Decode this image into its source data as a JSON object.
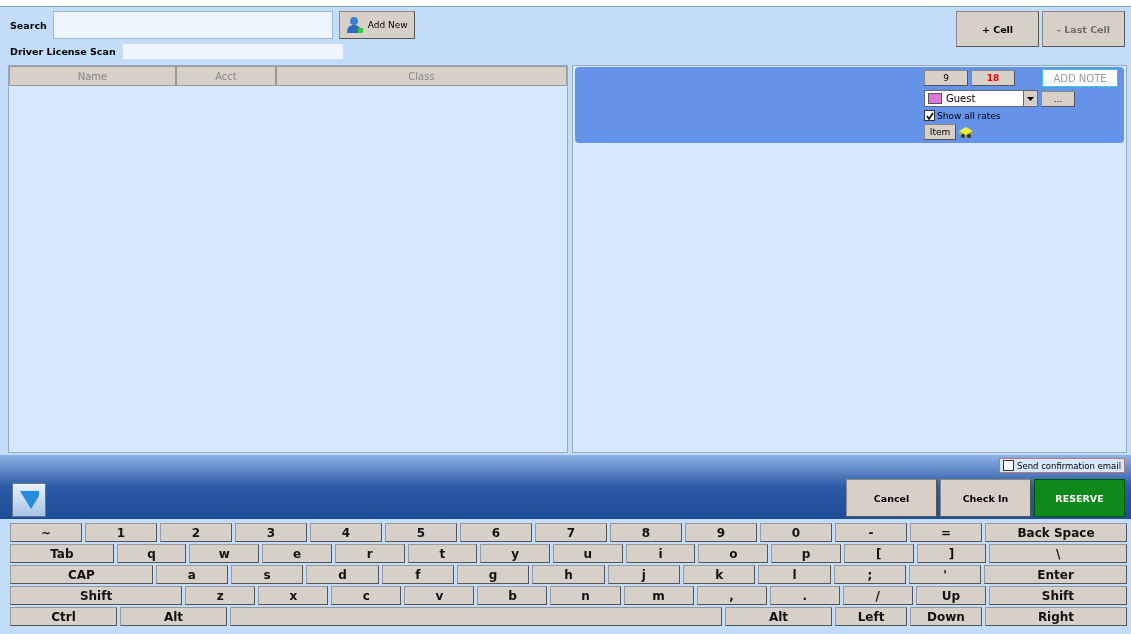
{
  "search": {
    "label": "Search",
    "add_new": "Add New"
  },
  "license_scan": {
    "label": "Driver License Scan"
  },
  "cell_buttons": [
    {
      "label": "+ Cell",
      "disabled": false
    },
    {
      "label": "- Last Cell",
      "disabled": true
    }
  ],
  "table": {
    "columns": [
      "Name",
      "Acct",
      "Class"
    ]
  },
  "cell": {
    "count_a": "9",
    "count_b": "18",
    "note": "ADD NOTE",
    "rate_type": {
      "value": "Guest",
      "color": "#dd77dd"
    },
    "more": "...",
    "show_all_rates": {
      "label": "Show all rates",
      "checked": true
    },
    "item": "Item"
  },
  "send_confirmation": {
    "label": "Send confirmation email",
    "checked": false
  },
  "actions": [
    {
      "label": "Cancel",
      "kind": "plain"
    },
    {
      "label": "Check In",
      "kind": "plain"
    },
    {
      "label": "RESERVE",
      "kind": "primary"
    }
  ],
  "keyboard": [
    [
      {
        "label": "~",
        "kind": "char"
      },
      {
        "label": "1",
        "kind": "char"
      },
      {
        "label": "2",
        "kind": "char"
      },
      {
        "label": "3",
        "kind": "char"
      },
      {
        "label": "4",
        "kind": "char"
      },
      {
        "label": "5",
        "kind": "char"
      },
      {
        "label": "6",
        "kind": "char"
      },
      {
        "label": "7",
        "kind": "char"
      },
      {
        "label": "8",
        "kind": "char"
      },
      {
        "label": "9",
        "kind": "char"
      },
      {
        "label": "0",
        "kind": "char"
      },
      {
        "label": "-",
        "kind": "char"
      },
      {
        "label": "=",
        "kind": "char"
      },
      {
        "label": "Back Space",
        "kind": "wide"
      }
    ],
    [
      {
        "label": "Tab",
        "kind": "mod"
      },
      {
        "label": "q",
        "kind": "char"
      },
      {
        "label": "w",
        "kind": "char"
      },
      {
        "label": "e",
        "kind": "char"
      },
      {
        "label": "r",
        "kind": "char"
      },
      {
        "label": "t",
        "kind": "char"
      },
      {
        "label": "y",
        "kind": "char"
      },
      {
        "label": "u",
        "kind": "char"
      },
      {
        "label": "i",
        "kind": "char"
      },
      {
        "label": "o",
        "kind": "char"
      },
      {
        "label": "p",
        "kind": "char"
      },
      {
        "label": "[",
        "kind": "char"
      },
      {
        "label": "]",
        "kind": "char"
      },
      {
        "label": "\\",
        "kind": "wide"
      }
    ],
    [
      {
        "label": "CAP",
        "kind": "cap"
      },
      {
        "label": "a",
        "kind": "char"
      },
      {
        "label": "s",
        "kind": "char"
      },
      {
        "label": "d",
        "kind": "char"
      },
      {
        "label": "f",
        "kind": "char"
      },
      {
        "label": "g",
        "kind": "char"
      },
      {
        "label": "h",
        "kind": "char"
      },
      {
        "label": "j",
        "kind": "char"
      },
      {
        "label": "k",
        "kind": "char"
      },
      {
        "label": "l",
        "kind": "char"
      },
      {
        "label": ";",
        "kind": "char"
      },
      {
        "label": "'",
        "kind": "char"
      },
      {
        "label": "Enter",
        "kind": "wide"
      }
    ],
    [
      {
        "label": "Shift",
        "kind": "shift"
      },
      {
        "label": "z",
        "kind": "char"
      },
      {
        "label": "x",
        "kind": "char"
      },
      {
        "label": "c",
        "kind": "char"
      },
      {
        "label": "v",
        "kind": "char"
      },
      {
        "label": "b",
        "kind": "char"
      },
      {
        "label": "n",
        "kind": "char"
      },
      {
        "label": "m",
        "kind": "char"
      },
      {
        "label": ",",
        "kind": "char"
      },
      {
        "label": ".",
        "kind": "char"
      },
      {
        "label": "/",
        "kind": "char"
      },
      {
        "label": "Up",
        "kind": "char"
      },
      {
        "label": "Shift",
        "kind": "wide"
      }
    ],
    [
      {
        "label": "Ctrl",
        "kind": "mod"
      },
      {
        "label": "Alt",
        "kind": "mod"
      },
      {
        "kind": "space"
      },
      {
        "label": "Alt",
        "kind": "mod"
      },
      {
        "label": "Left",
        "kind": "char"
      },
      {
        "label": "Down",
        "kind": "char"
      },
      {
        "label": "Right",
        "kind": "wide"
      }
    ]
  ]
}
